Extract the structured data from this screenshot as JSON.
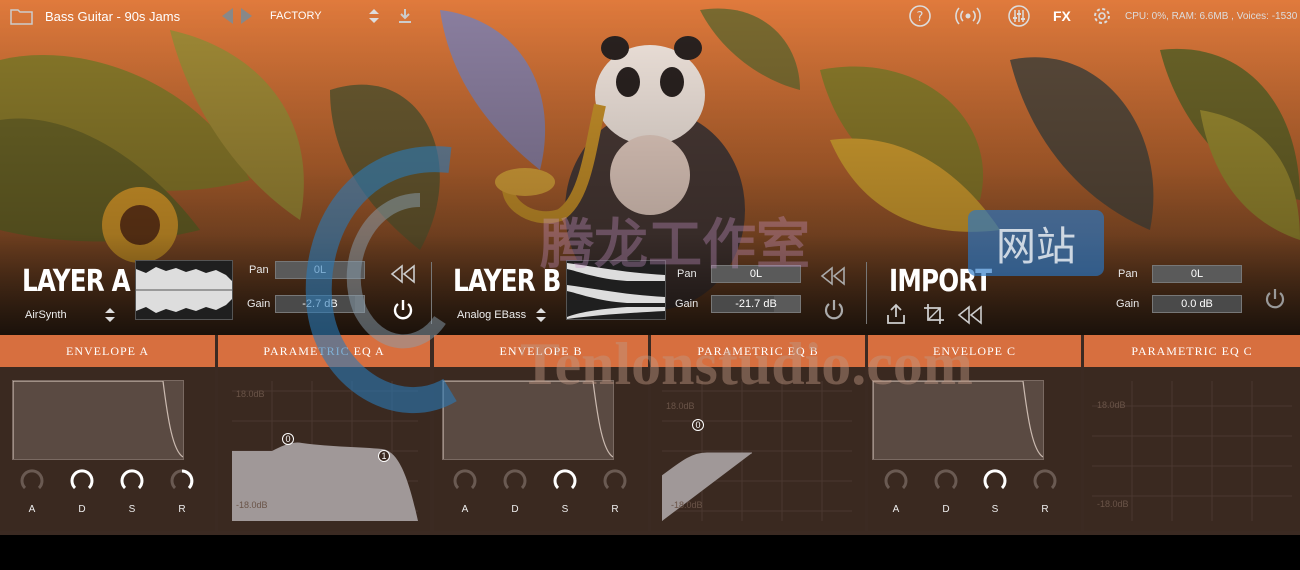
{
  "topbar": {
    "preset_name": "Bass Guitar - 90s Jams",
    "bank": "FACTORY",
    "fx_label": "FX",
    "status": "CPU: 0%, RAM: 6.6MB , Voices: -1530",
    "icons": [
      "folder-icon",
      "prev-arrow-icon",
      "next-arrow-icon",
      "updown-icon",
      "download-icon",
      "help-icon",
      "broadcast-icon",
      "mixer-icon",
      "gear-icon"
    ]
  },
  "layers": [
    {
      "title": "LAYER A",
      "source": "AirSynth",
      "pan_label": "Pan",
      "pan": "0L",
      "gain_label": "Gain",
      "gain": "-2.7 dB",
      "gain_level": 0.9
    },
    {
      "title": "LAYER B",
      "source": "Analog EBass",
      "pan_label": "Pan",
      "pan": "0L",
      "gain_label": "Gain",
      "gain": "-21.7 dB",
      "gain_level": 0.7
    },
    {
      "title": "IMPORT",
      "pan_label": "Pan",
      "pan": "0L",
      "gain_label": "Gain",
      "gain": "0.0 dB",
      "gain_level": 1.0
    }
  ],
  "tabs": [
    "ENVELOPE A",
    "PARAMETRIC EQ A",
    "ENVELOPE B",
    "PARAMETRIC EQ B",
    "ENVELOPE C",
    "PARAMETRIC EQ C"
  ],
  "knob_labels": [
    "A",
    "D",
    "S",
    "R"
  ],
  "eq": {
    "top_label": "18.0dB",
    "bottom_label": "-18.0dB",
    "nodes_a": [
      "0",
      "1"
    ],
    "nodes_b": [
      "0"
    ]
  },
  "watermark": {
    "text": "Tenlonstudio.com",
    "cn": "腾龙工作室",
    "badge": "网站"
  },
  "colors": {
    "accent": "#d76f3f",
    "panel": "#3a2920"
  }
}
